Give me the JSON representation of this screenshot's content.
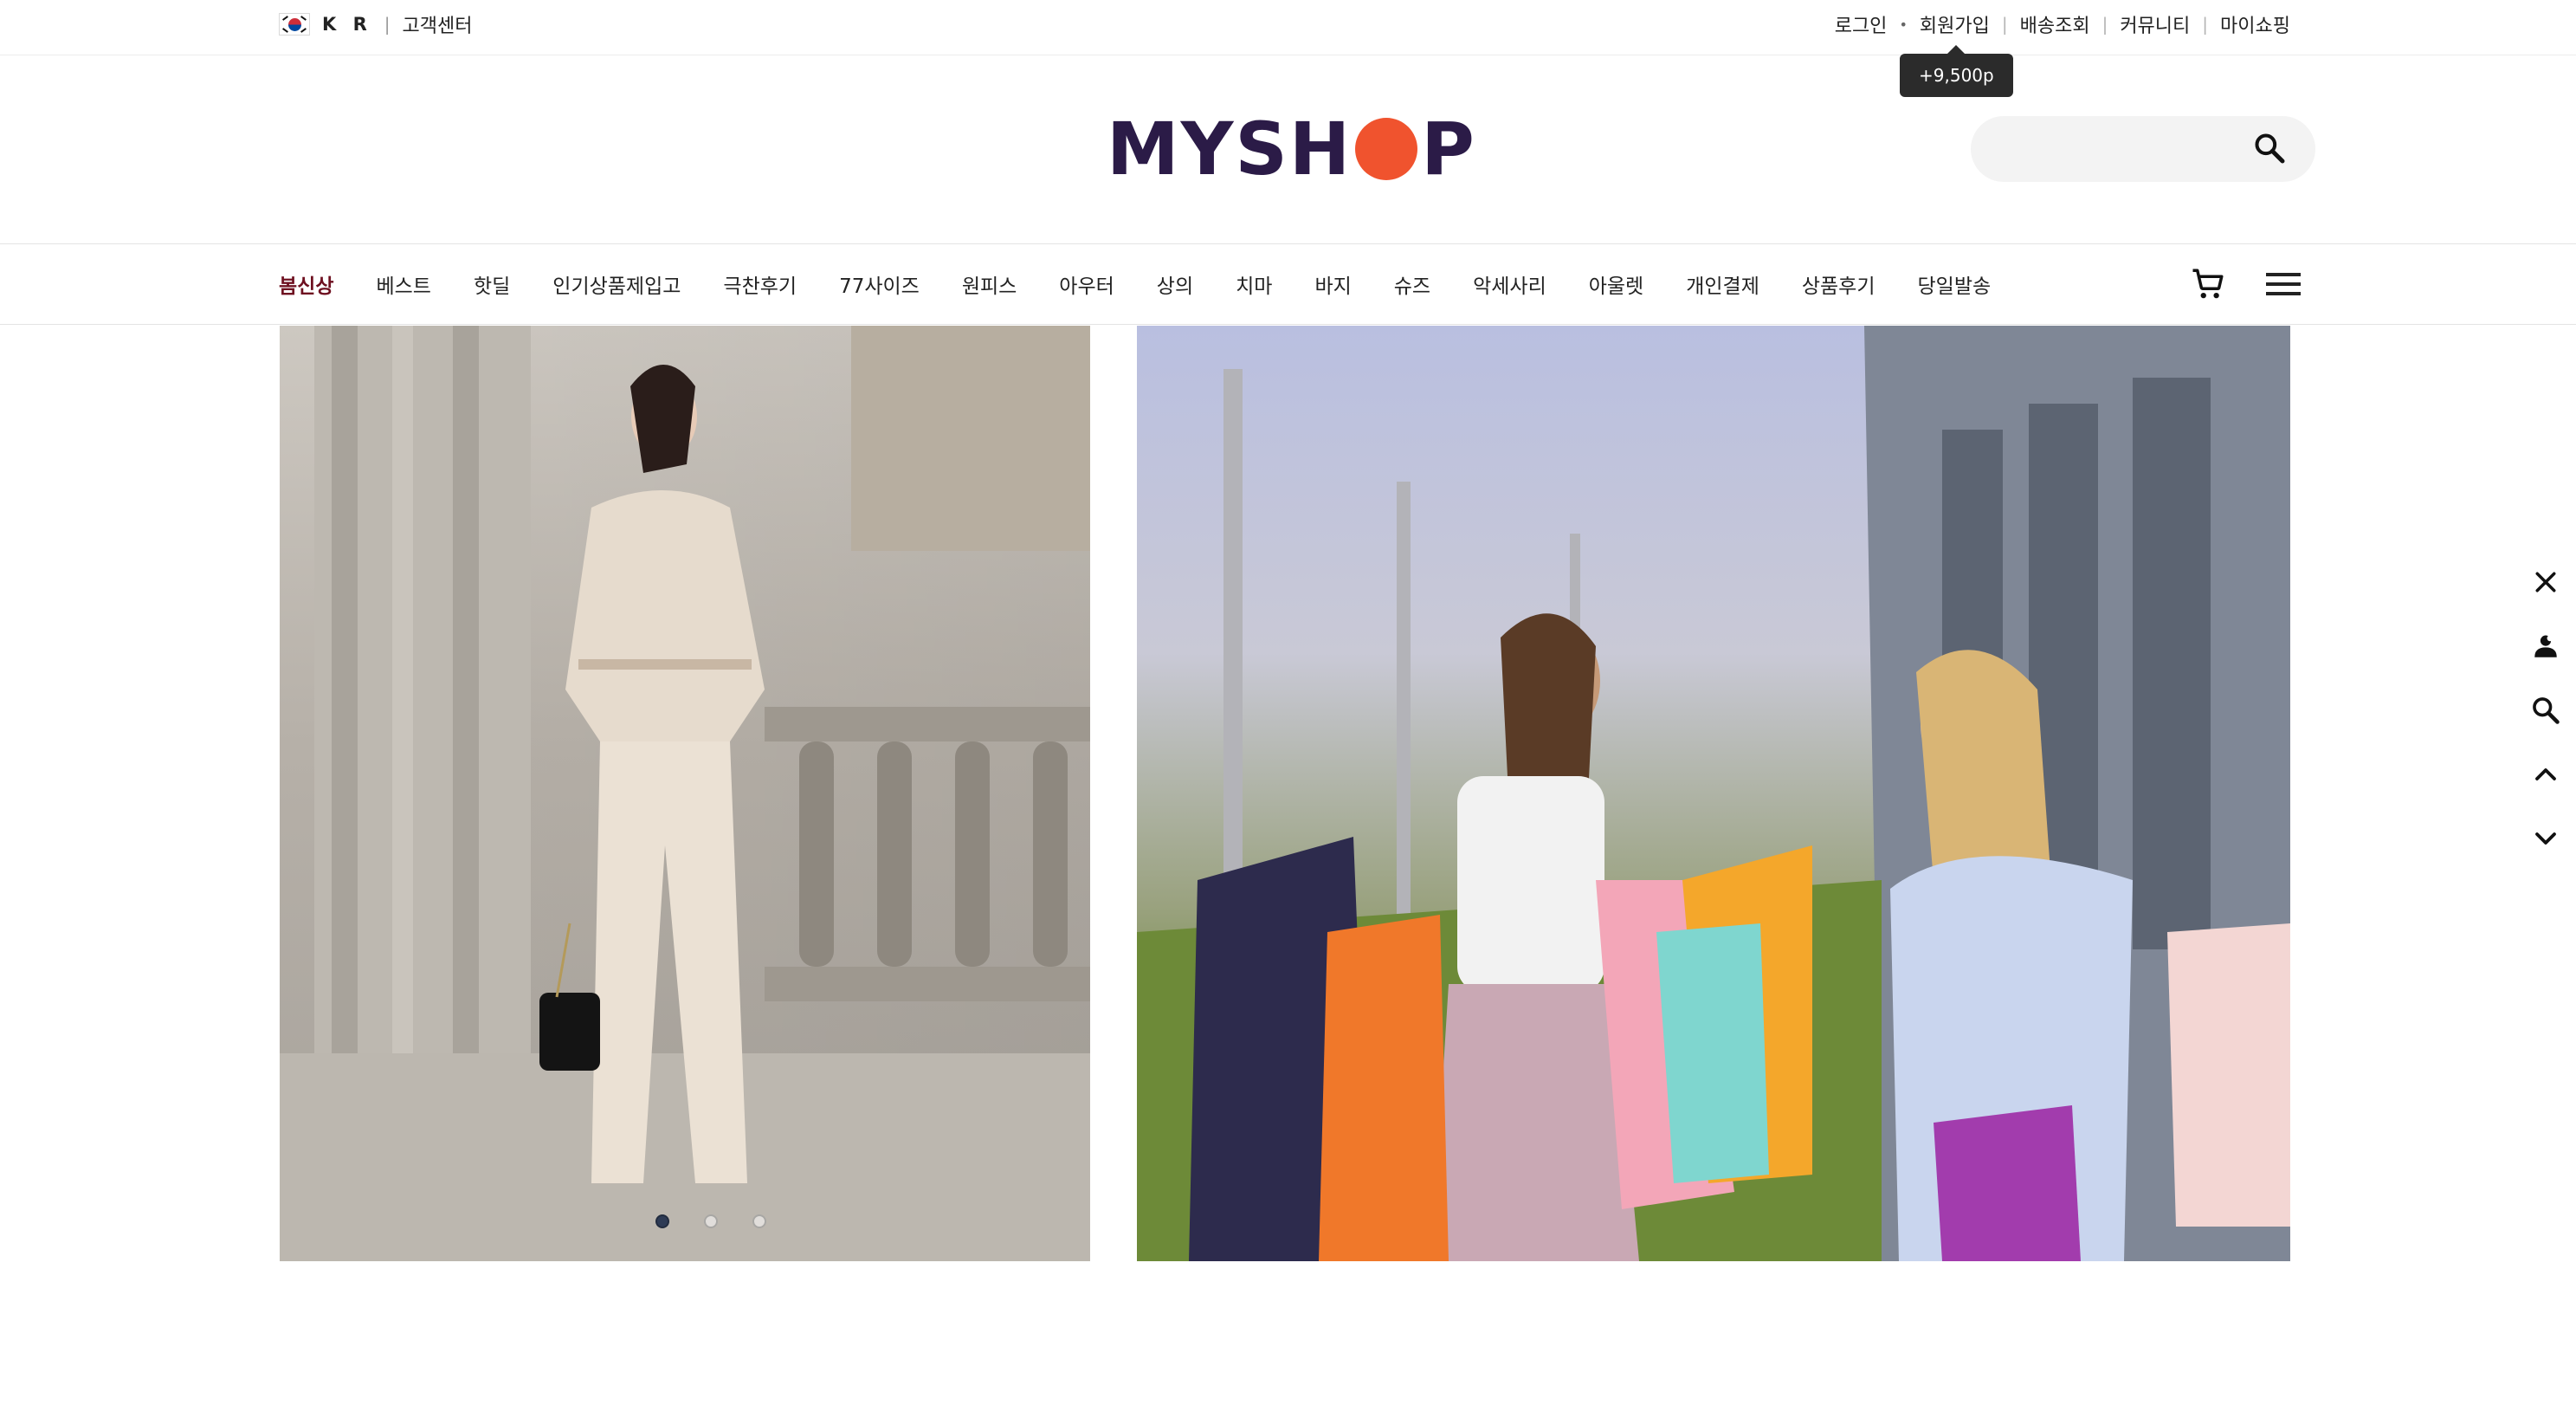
{
  "topbar": {
    "lang": "K R",
    "customer_center": "고객센터",
    "links": {
      "login": "로그인",
      "signup": "회원가입",
      "order_tracking": "배송조회",
      "community": "커뮤니티",
      "my_shopping": "마이쇼핑"
    },
    "signup_tooltip": "+9,500p"
  },
  "header": {
    "logo_text_left": "MYSH",
    "logo_text_right": "P",
    "search_placeholder": ""
  },
  "nav": {
    "items": [
      "봄신상",
      "베스트",
      "핫딜",
      "인기상품제입고",
      "극찬후기",
      "77사이즈",
      "원피스",
      "아우터",
      "상의",
      "치마",
      "바지",
      "슈즈",
      "악세사리",
      "아울렛",
      "개인결제",
      "상품후기",
      "당일발송"
    ],
    "active_index": 0
  },
  "banner": {
    "slide_count": 3,
    "active_slide": 0
  },
  "side_menu": [
    "close-icon",
    "user-icon",
    "search-icon",
    "chevron-up-icon",
    "chevron-down-icon"
  ],
  "colors": {
    "accent_active_nav": "#6e1020",
    "logo_text": "#2b1b47",
    "logo_dot": "#f0532e",
    "tooltip_bg": "#2b2b2b"
  }
}
